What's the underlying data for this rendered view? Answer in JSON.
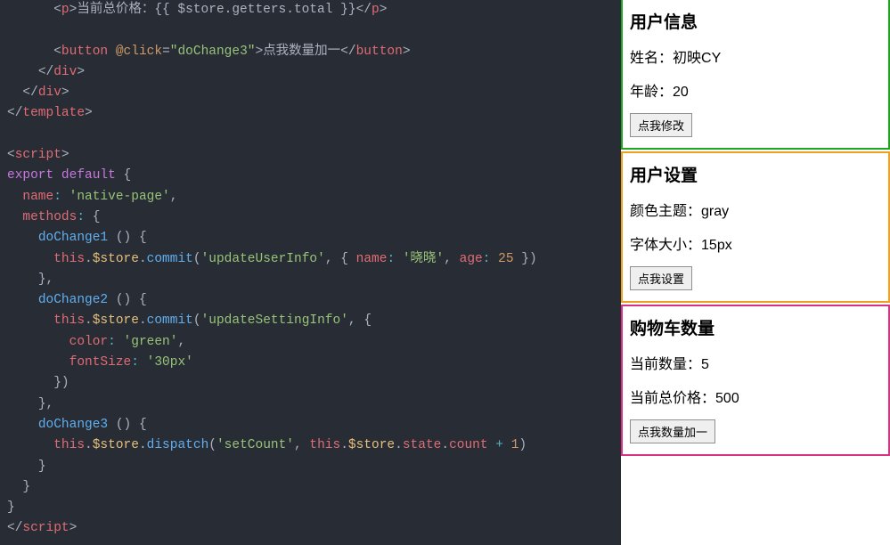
{
  "code": {
    "tokens": [
      [
        [
          "txt",
          "      "
        ],
        [
          "punct",
          "<"
        ],
        [
          "tag",
          "p"
        ],
        [
          "punct",
          ">"
        ],
        [
          "txt",
          "当前总价格：{{ $store.getters.total }}"
        ],
        [
          "punct",
          "</"
        ],
        [
          "tag",
          "p"
        ],
        [
          "punct",
          ">"
        ]
      ],
      [
        [
          "txt",
          ""
        ]
      ],
      [
        [
          "txt",
          "      "
        ],
        [
          "punct",
          "<"
        ],
        [
          "tag",
          "button"
        ],
        [
          "txt",
          " "
        ],
        [
          "attr",
          "@click"
        ],
        [
          "punct",
          "="
        ],
        [
          "str",
          "\"doChange3\""
        ],
        [
          "punct",
          ">"
        ],
        [
          "txt",
          "点我数量加一"
        ],
        [
          "punct",
          "</"
        ],
        [
          "tag",
          "button"
        ],
        [
          "punct",
          ">"
        ]
      ],
      [
        [
          "txt",
          "    "
        ],
        [
          "punct",
          "</"
        ],
        [
          "tag",
          "div"
        ],
        [
          "punct",
          ">"
        ]
      ],
      [
        [
          "txt",
          "  "
        ],
        [
          "punct",
          "</"
        ],
        [
          "tag",
          "div"
        ],
        [
          "punct",
          ">"
        ]
      ],
      [
        [
          "punct",
          "</"
        ],
        [
          "tag",
          "template"
        ],
        [
          "punct",
          ">"
        ]
      ],
      [
        [
          "txt",
          ""
        ]
      ],
      [
        [
          "punct",
          "<"
        ],
        [
          "tag",
          "script"
        ],
        [
          "punct",
          ">"
        ]
      ],
      [
        [
          "kw",
          "export"
        ],
        [
          "txt",
          " "
        ],
        [
          "kw",
          "default"
        ],
        [
          "txt",
          " "
        ],
        [
          "punct",
          "{"
        ]
      ],
      [
        [
          "txt",
          "  "
        ],
        [
          "prop",
          "name"
        ],
        [
          "op",
          ":"
        ],
        [
          "txt",
          " "
        ],
        [
          "str",
          "'native-page'"
        ],
        [
          "punct",
          ","
        ]
      ],
      [
        [
          "txt",
          "  "
        ],
        [
          "prop",
          "methods"
        ],
        [
          "op",
          ":"
        ],
        [
          "txt",
          " "
        ],
        [
          "punct",
          "{"
        ]
      ],
      [
        [
          "txt",
          "    "
        ],
        [
          "func",
          "doChange1"
        ],
        [
          "txt",
          " "
        ],
        [
          "punct",
          "()"
        ],
        [
          "txt",
          " "
        ],
        [
          "punct",
          "{"
        ]
      ],
      [
        [
          "txt",
          "      "
        ],
        [
          "this",
          "this"
        ],
        [
          "punct",
          "."
        ],
        [
          "varname",
          "$store"
        ],
        [
          "punct",
          "."
        ],
        [
          "func",
          "commit"
        ],
        [
          "punct",
          "("
        ],
        [
          "str",
          "'updateUserInfo'"
        ],
        [
          "punct",
          ","
        ],
        [
          "txt",
          " "
        ],
        [
          "punct",
          "{"
        ],
        [
          "txt",
          " "
        ],
        [
          "prop",
          "name"
        ],
        [
          "op",
          ":"
        ],
        [
          "txt",
          " "
        ],
        [
          "str",
          "'晓晓'"
        ],
        [
          "punct",
          ","
        ],
        [
          "txt",
          " "
        ],
        [
          "prop",
          "age"
        ],
        [
          "op",
          ":"
        ],
        [
          "txt",
          " "
        ],
        [
          "num",
          "25"
        ],
        [
          "txt",
          " "
        ],
        [
          "punct",
          "}"
        ],
        [
          "punct",
          ")"
        ]
      ],
      [
        [
          "txt",
          "    "
        ],
        [
          "punct",
          "}"
        ],
        [
          "punct",
          ","
        ]
      ],
      [
        [
          "txt",
          "    "
        ],
        [
          "func",
          "doChange2"
        ],
        [
          "txt",
          " "
        ],
        [
          "punct",
          "()"
        ],
        [
          "txt",
          " "
        ],
        [
          "punct",
          "{"
        ]
      ],
      [
        [
          "txt",
          "      "
        ],
        [
          "this",
          "this"
        ],
        [
          "punct",
          "."
        ],
        [
          "varname",
          "$store"
        ],
        [
          "punct",
          "."
        ],
        [
          "func",
          "commit"
        ],
        [
          "punct",
          "("
        ],
        [
          "str",
          "'updateSettingInfo'"
        ],
        [
          "punct",
          ","
        ],
        [
          "txt",
          " "
        ],
        [
          "punct",
          "{"
        ]
      ],
      [
        [
          "txt",
          "        "
        ],
        [
          "prop",
          "color"
        ],
        [
          "op",
          ":"
        ],
        [
          "txt",
          " "
        ],
        [
          "str",
          "'green'"
        ],
        [
          "punct",
          ","
        ]
      ],
      [
        [
          "txt",
          "        "
        ],
        [
          "prop",
          "fontSize"
        ],
        [
          "op",
          ":"
        ],
        [
          "txt",
          " "
        ],
        [
          "str",
          "'30px'"
        ]
      ],
      [
        [
          "txt",
          "      "
        ],
        [
          "punct",
          "}"
        ],
        [
          "punct",
          ")"
        ]
      ],
      [
        [
          "txt",
          "    "
        ],
        [
          "punct",
          "}"
        ],
        [
          "punct",
          ","
        ]
      ],
      [
        [
          "txt",
          "    "
        ],
        [
          "func",
          "doChange3"
        ],
        [
          "txt",
          " "
        ],
        [
          "punct",
          "()"
        ],
        [
          "txt",
          " "
        ],
        [
          "punct",
          "{"
        ]
      ],
      [
        [
          "txt",
          "      "
        ],
        [
          "this",
          "this"
        ],
        [
          "punct",
          "."
        ],
        [
          "varname",
          "$store"
        ],
        [
          "punct",
          "."
        ],
        [
          "func",
          "dispatch"
        ],
        [
          "punct",
          "("
        ],
        [
          "str",
          "'setCount'"
        ],
        [
          "punct",
          ","
        ],
        [
          "txt",
          " "
        ],
        [
          "this",
          "this"
        ],
        [
          "punct",
          "."
        ],
        [
          "varname",
          "$store"
        ],
        [
          "punct",
          "."
        ],
        [
          "prop",
          "state"
        ],
        [
          "punct",
          "."
        ],
        [
          "prop",
          "count"
        ],
        [
          "txt",
          " "
        ],
        [
          "op",
          "+"
        ],
        [
          "txt",
          " "
        ],
        [
          "num",
          "1"
        ],
        [
          "punct",
          ")"
        ]
      ],
      [
        [
          "txt",
          "    "
        ],
        [
          "punct",
          "}"
        ]
      ],
      [
        [
          "txt",
          "  "
        ],
        [
          "punct",
          "}"
        ]
      ],
      [
        [
          "punct",
          "}"
        ]
      ],
      [
        [
          "punct",
          "</"
        ],
        [
          "tag",
          "script"
        ],
        [
          "punct",
          ">"
        ]
      ]
    ]
  },
  "preview": {
    "userInfo": {
      "title": "用户信息",
      "nameLabel": "姓名：",
      "nameValue": "初映CY",
      "ageLabel": "年龄：",
      "ageValue": "20",
      "button": "点我修改"
    },
    "userSetting": {
      "title": "用户设置",
      "themeLabel": "颜色主题：",
      "themeValue": "gray",
      "fontLabel": "字体大小：",
      "fontValue": "15px",
      "button": "点我设置"
    },
    "cart": {
      "title": "购物车数量",
      "countLabel": "当前数量：",
      "countValue": "5",
      "totalLabel": "当前总价格：",
      "totalValue": "500",
      "button": "点我数量加一"
    }
  }
}
